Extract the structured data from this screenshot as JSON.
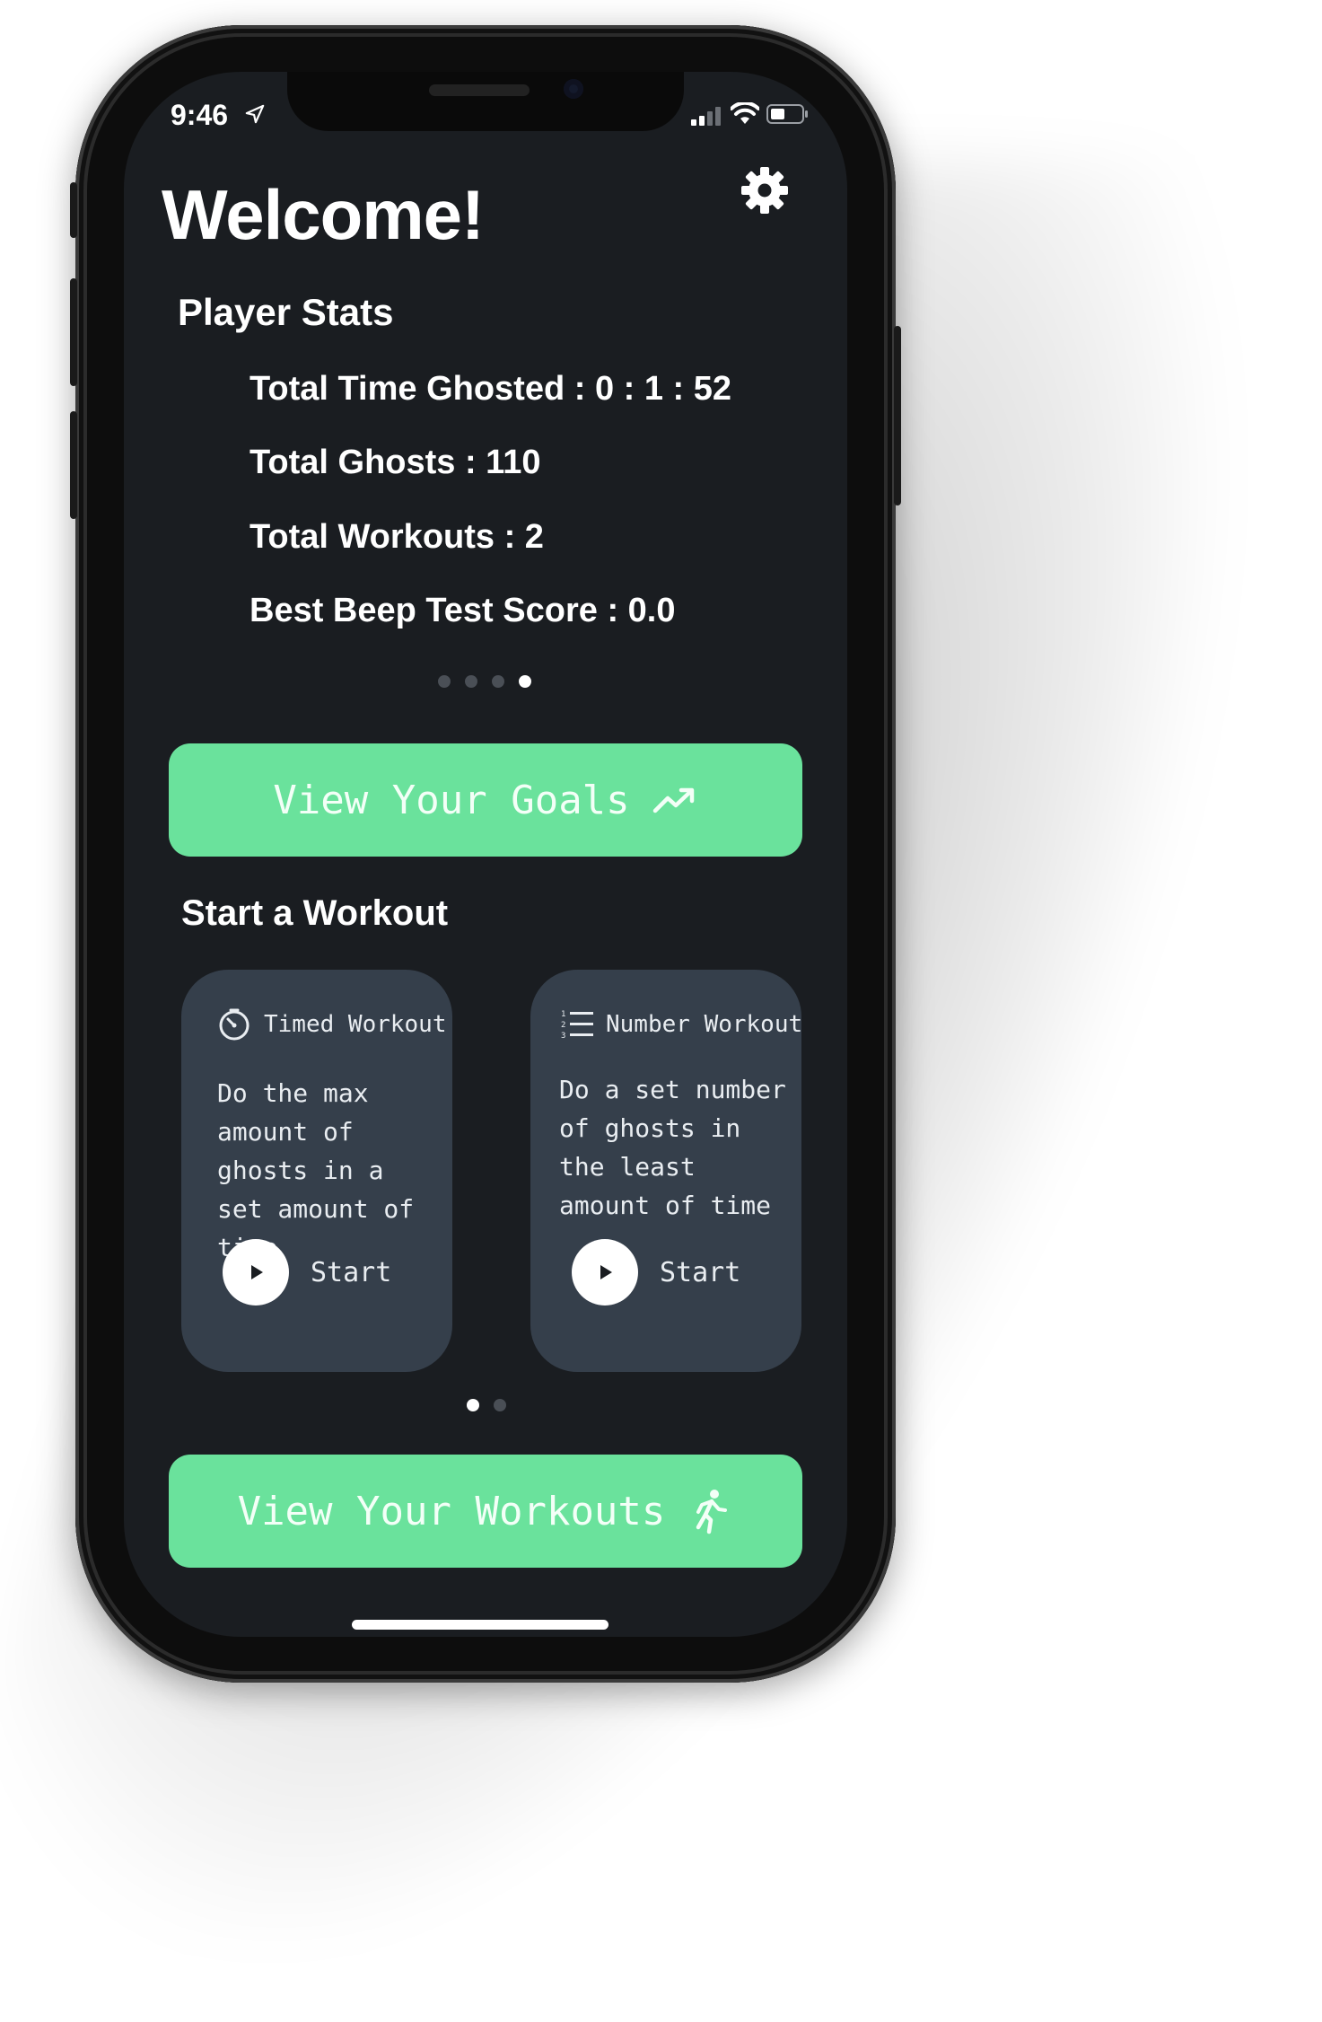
{
  "status_bar": {
    "time": "9:46"
  },
  "header": {
    "title": "Welcome!"
  },
  "player_stats": {
    "heading": "Player Stats",
    "items": [
      "Total Time Ghosted : 0 : 1 : 52",
      "Total Ghosts : 110",
      "Total Workouts : 2",
      "Best Beep Test Score : 0.0"
    ],
    "page_count": 4,
    "active_page": 4
  },
  "goals_button": {
    "label": "View Your Goals",
    "icon": "trending-up-icon"
  },
  "workouts_section": {
    "heading": "Start a Workout",
    "cards": [
      {
        "title": "Timed Workout",
        "icon": "timer-icon",
        "description": "Do the max amount of ghosts in a set amount of time",
        "start_label": "Start"
      },
      {
        "title": "Number Workout",
        "icon": "numbered-list-icon",
        "description": "Do a set number of ghosts in the least amount of time",
        "start_label": "Start"
      }
    ],
    "page_count": 2,
    "active_page": 1
  },
  "workouts_button": {
    "label": "View Your Workouts",
    "icon": "running-person-icon"
  },
  "colors": {
    "background": "#1a1d21",
    "card": "#353f4b",
    "accent_green": "#6ae29c",
    "text": "#ffffff"
  }
}
